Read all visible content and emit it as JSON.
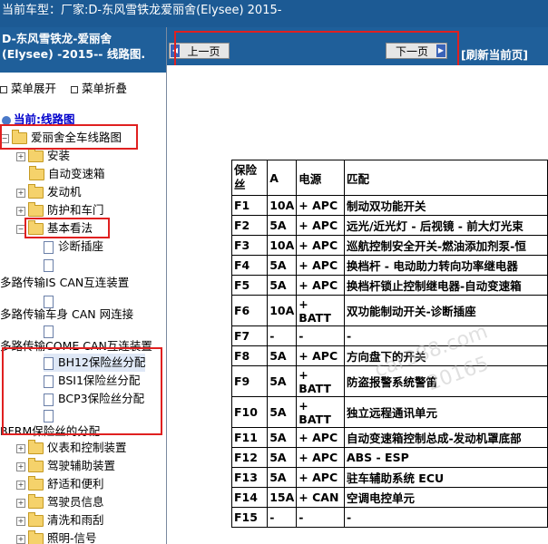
{
  "topbar": {
    "label": "当前车型：",
    "value": "厂家:D-东风雪铁龙爱丽舍(Elysee)   2015-"
  },
  "left_panel": {
    "title_line1": "D-东风雪铁龙-爱丽舍",
    "title_line2": "(Elysee)   -2015-- 线路图.",
    "expand_label": "菜单展开",
    "collapse_label": "菜单折叠",
    "current_label": "当前:线路图",
    "tree": {
      "root": "爱丽舍全车线路图",
      "n1": "安装",
      "n2": "自动变速箱",
      "n3": "发动机",
      "n4": "防护和车门",
      "n5": "基本看法",
      "n6": "诊断插座",
      "n7": "多路传输IS CAN互连装置",
      "n8": "多路传输车身 CAN 网连接",
      "n9": "多路传输COME CAN互连装置",
      "n10": "BH12保险丝分配",
      "n11": "BSI1保险丝分配",
      "n12": "BCP3保险丝分配",
      "n13": "BFRM保险丝的分配",
      "n14": "仪表和控制装置",
      "n15": "驾驶辅助装置",
      "n16": "舒适和便利",
      "n17": "驾驶员信息",
      "n18": "清洗和雨刮",
      "n19": "照明-信号"
    }
  },
  "nav": {
    "prev_label": "上一页",
    "next_label": "下一页",
    "refresh_label": "[刷新当前页]"
  },
  "fuse_table": {
    "headers": [
      "保险丝",
      "A",
      "电源",
      "匹配"
    ],
    "rows": [
      [
        "F1",
        "10A",
        "+ APC",
        "制动双功能开关"
      ],
      [
        "F2",
        "5A",
        "+ APC",
        "远光/近光灯 - 后视镜 - 前大灯光束"
      ],
      [
        "F3",
        "10A",
        "+ APC",
        "巡航控制安全开关-燃油添加剂泵-恒"
      ],
      [
        "F4",
        "5A",
        "+ APC",
        "换档杆 - 电动助力转向功率继电器"
      ],
      [
        "F5",
        "5A",
        "+ APC",
        "换档杆锁止控制继电器-自动变速箱"
      ],
      [
        "F6",
        "10A",
        "+ BATT",
        "双功能制动开关-诊断插座"
      ],
      [
        "F7",
        "-",
        "-",
        "-"
      ],
      [
        "F8",
        "5A",
        "+ APC",
        "方向盘下的开关"
      ],
      [
        "F9",
        "5A",
        "+ BATT",
        "防盗报警系统警笛"
      ],
      [
        "F10",
        "5A",
        "+ BATT",
        "独立远程通讯单元"
      ],
      [
        "F11",
        "5A",
        "+ APC",
        "自动变速箱控制总成-发动机罩底部"
      ],
      [
        "F12",
        "5A",
        "+ APC",
        "ABS - ESP"
      ],
      [
        "F13",
        "5A",
        "+ APC",
        "驻车辅助系统  ECU"
      ],
      [
        "F14",
        "15A",
        "+ CAN",
        "空调电控单元"
      ],
      [
        "F15",
        "-",
        "-",
        "-"
      ]
    ]
  },
  "watermark": {
    "line1": "car388.com",
    "line2": "20165"
  },
  "colors": {
    "header_blue": "#1f5f9a",
    "highlight_red": "#e02020",
    "folder_yellow": "#f5d26b"
  }
}
